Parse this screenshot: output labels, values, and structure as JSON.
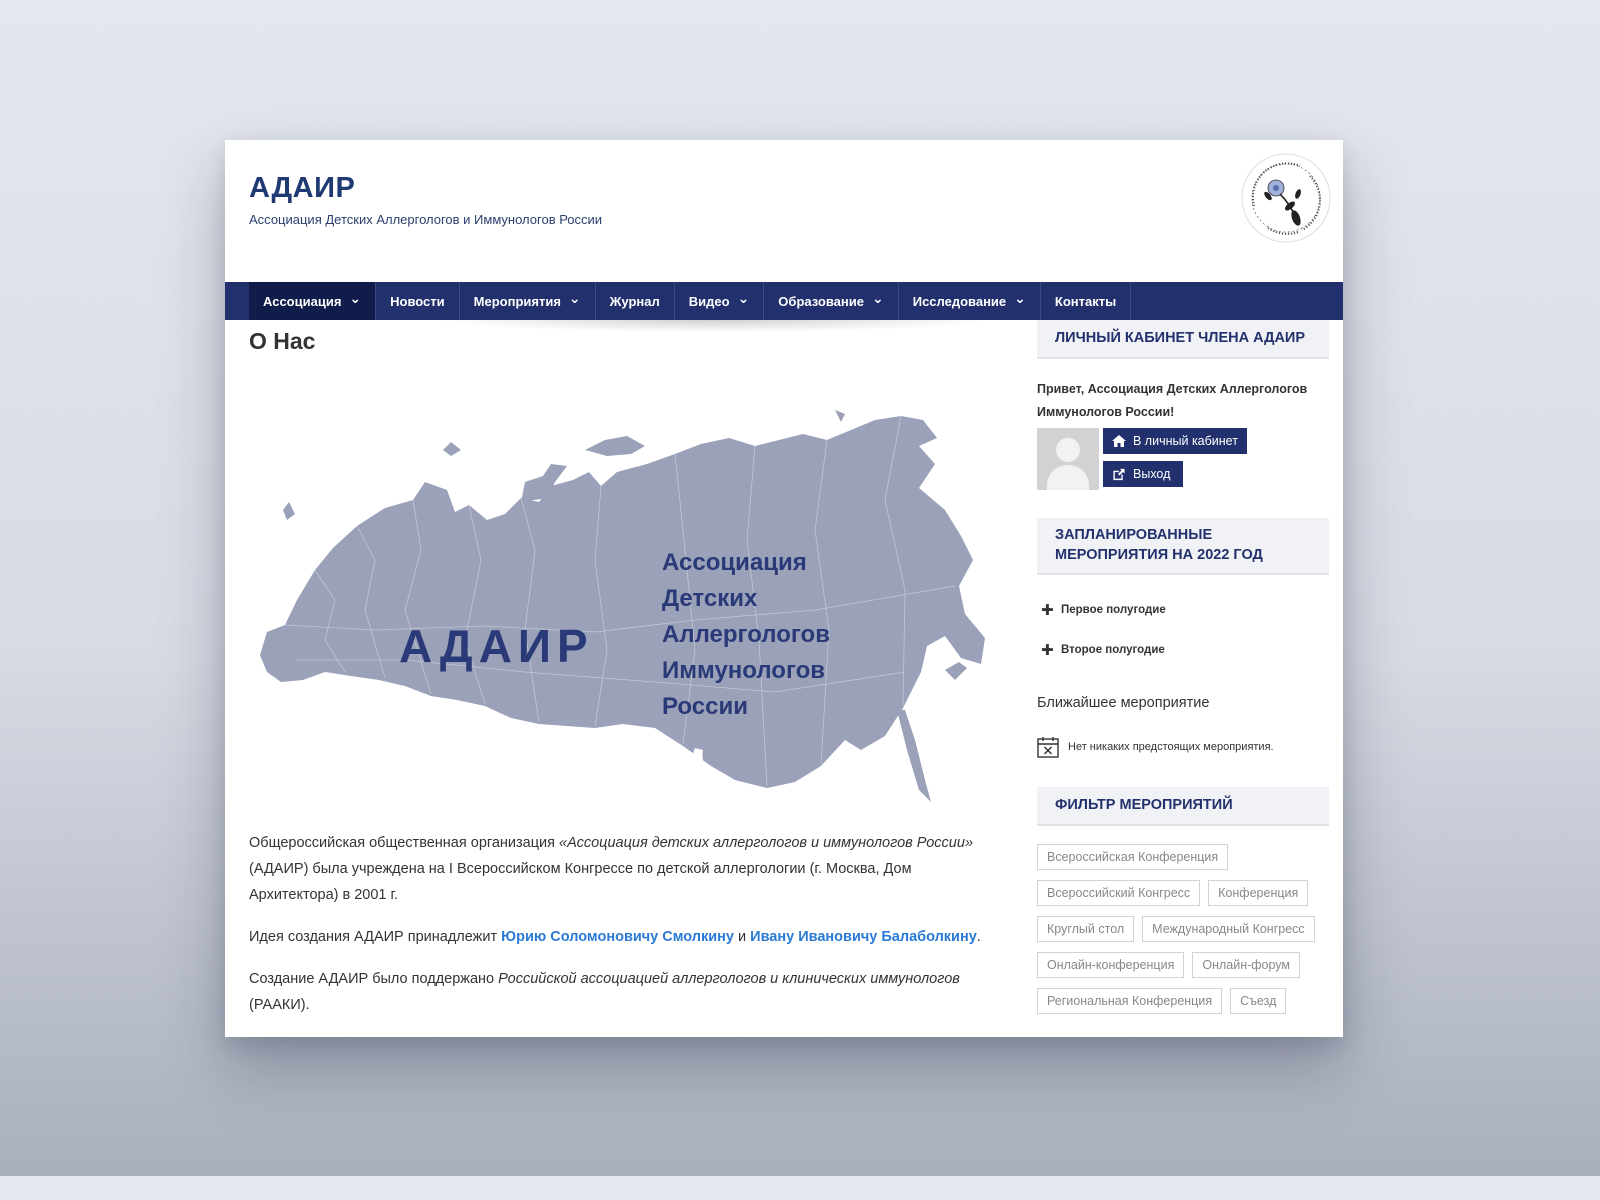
{
  "header": {
    "title": "АДАИР",
    "subtitle": "Ассоциация Детских Аллергологов и Иммунологов России"
  },
  "nav": {
    "items": [
      {
        "label": "Ассоциация",
        "dropdown": true,
        "active": true
      },
      {
        "label": "Новости",
        "dropdown": false
      },
      {
        "label": "Мероприятия",
        "dropdown": true
      },
      {
        "label": "Журнал",
        "dropdown": false
      },
      {
        "label": "Видео",
        "dropdown": true
      },
      {
        "label": "Образование",
        "dropdown": true
      },
      {
        "label": "Исследование",
        "dropdown": true
      },
      {
        "label": "Контакты",
        "dropdown": false
      }
    ]
  },
  "main": {
    "page_title": "О Нас",
    "map": {
      "big_label": "АДАИР",
      "caption_lines": [
        "Ассоциация",
        "Детских",
        "Аллергологов",
        "Иммунологов",
        "России"
      ]
    },
    "p1_text": "Общероссийская общественная организация ",
    "p1_em": "«Ассоциация детских аллергологов и иммунологов России»",
    "p1_rest": " (АДАИР) была учреждена на I Всероссийском Конгрессе по детской аллергологии (г. Москва, Дом Архитектора) в 2001 г.",
    "p2_text": "Идея создания АДАИР принадлежит ",
    "p2_link1": "Юрию Соломоновичу Смолкину",
    "p2_mid": " и ",
    "p2_link2": "Ивану Ивановичу Балаболкину",
    "p2_end": ".",
    "p3_text": "Создание АДАИР было поддержано ",
    "p3_em": "Российской ассоциацией аллергологов и клинических иммунологов",
    "p3_rest": " (РААКИ)."
  },
  "sidebar": {
    "cabinet": {
      "title": "Личный кабинет члена АДАИР",
      "greeting": "Привет, Ассоциация Детских Аллергологов Иммунологов России!",
      "cabinet_button": "В личный кабинет",
      "logout_button": "Выход"
    },
    "planned": {
      "title_line1": "Запланированные",
      "title_line2": "мероприятия на 2022 год",
      "first_half": "Первое полугодие",
      "second_half": "Второе полугодие"
    },
    "nearest": {
      "title": "Ближайшее мероприятие",
      "no_events": "Нет никаких предстоящих мероприятия."
    },
    "filter": {
      "title": "Фильтр мероприятий",
      "tags": [
        "Всероссийская Конференция",
        "Всероссийский Конгресс",
        "Конференция",
        "Круглый стол",
        "Международный Конгресс",
        "Онлайн-конференция",
        "Онлайн-форум",
        "Региональная Конференция",
        "Съезд"
      ]
    }
  },
  "icons": {
    "nav_dropdown": "chevron-down-icon",
    "cabinet": "home-icon",
    "logout": "external-link-icon",
    "expand": "plus-icon",
    "calendar": "calendar-x-icon"
  },
  "colors": {
    "nav_bg": "#22316d",
    "nav_active": "#101c4a",
    "title": "#1f3a73",
    "map_fill": "#9aa1b8",
    "map_text": "#2a3a78",
    "link": "#2a7ad6"
  }
}
